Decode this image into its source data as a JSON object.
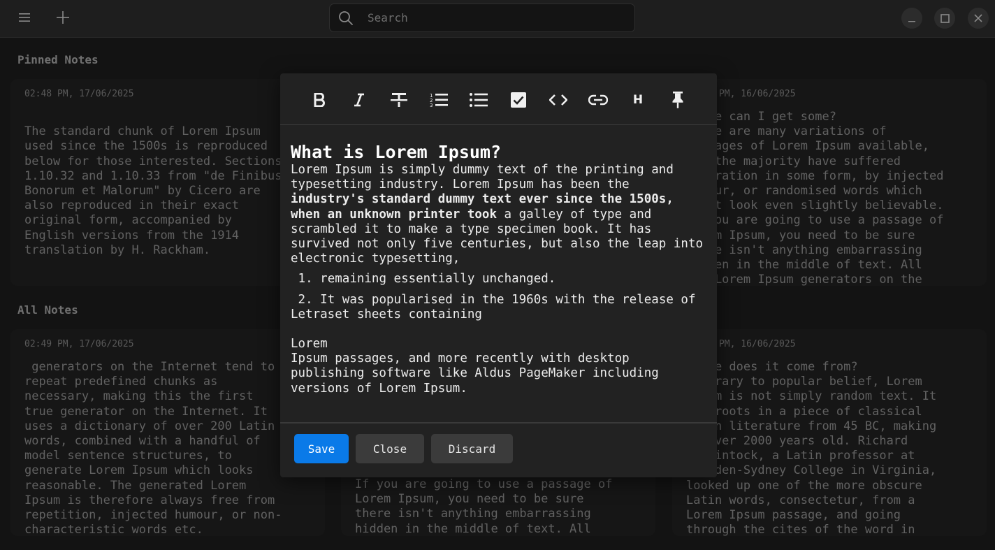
{
  "titlebar": {
    "search_placeholder": "Search",
    "icons": [
      "hamburger-menu-icon",
      "plus-icon",
      "search-icon",
      "minimize-icon",
      "maximize-icon",
      "close-icon"
    ]
  },
  "pinned": {
    "title": "Pinned Notes",
    "cards": [
      {
        "date": "02:48 PM, 17/06/2025",
        "body": "\nThe standard chunk of Lorem Ipsum\nused since the 1500s is reproduced\nbelow for those interested. Sections\n1.10.32 and 1.10.33 from \"de Finibus\nBonorum et Malorum\" by Cicero are\nalso reproduced in their exact\noriginal form, accompanied by\nEnglish versions from the 1914\ntranslation by H. Rackham."
      },
      {
        "date": "02:47 PM, 16/06/2025",
        "body": "Where can I get some?\nThere are many variations of\npassages of Lorem Ipsum available,\nbut the majority have suffered\nalteration in some form, by injected\nhumour, or randomised words which\ndon't look even slightly believable.\nIf you are going to use a passage of\nLorem Ipsum, you need to be sure\nthere isn't anything embarrassing\nhidden in the middle of text. All\nthe Lorem Ipsum generators on the"
      }
    ]
  },
  "all": {
    "title": "All Notes",
    "cards": [
      {
        "date": "02:49 PM, 17/06/2025",
        "body": " generators on the Internet tend to\nrepeat predefined chunks as\nnecessary, making this the first\ntrue generator on the Internet. It\nuses a dictionary of over 200 Latin\nwords, combined with a handful of\nmodel sentence structures, to\ngenerate Lorem Ipsum which looks\nreasonable. The generated Lorem\nIpsum is therefore always free from\nrepetition, injected humour, or non-\ncharacteristic words etc."
      },
      {
        "date": "",
        "body": "If you are going to use a passage of\nLorem Ipsum, you need to be sure\nthere isn't anything embarrassing\nhidden in the middle of text. All"
      },
      {
        "date": "02:46 PM, 16/06/2025",
        "body": "Where does it come from?\nContrary to popular belief, Lorem\nIpsum is not simply random text. It\nhas roots in a piece of classical\nLatin literature from 45 BC, making\nit over 2000 years old. Richard\nMcClintock, a Latin professor at\nHampden-Sydney College in Virginia,\nlooked up one of the more obscure\nLatin words, consectetur, from a\nLorem Ipsum passage, and going\nthrough the cites of the word in"
      }
    ]
  },
  "modal": {
    "toolbar": [
      "bold-icon",
      "italic-icon",
      "strikethrough-icon",
      "ordered-list-icon",
      "bullet-list-icon",
      "checkbox-icon",
      "code-icon",
      "link-icon",
      "heading-icon",
      "pin-icon"
    ],
    "heading_glyph": "H",
    "heading": "What is Lorem Ipsum?",
    "para1_a": "Lorem Ipsum is simply dummy text of the printing and typesetting industry. Lorem Ipsum has been the ",
    "para1_bold": "industry's standard dummy text ever since the 1500s, when an unknown printer took",
    "para1_b": " a galley of type and scrambled it to make a type specimen book. It has survived not only five centuries, but also the leap into electronic typesetting,",
    "list": [
      {
        "num": "1.",
        "text": "remaining essentially unchanged."
      },
      {
        "num": "2.",
        "text": "It was popularised in the 1960s with the release of Letraset sheets containing"
      }
    ],
    "para2_line1": "Lorem",
    "para2_rest": "Ipsum passages, and more recently with desktop publishing software like Aldus PageMaker including versions of Lorem Ipsum.",
    "save": "Save",
    "close": "Close",
    "discard": "Discard",
    "accent": "#0a7ae8"
  }
}
